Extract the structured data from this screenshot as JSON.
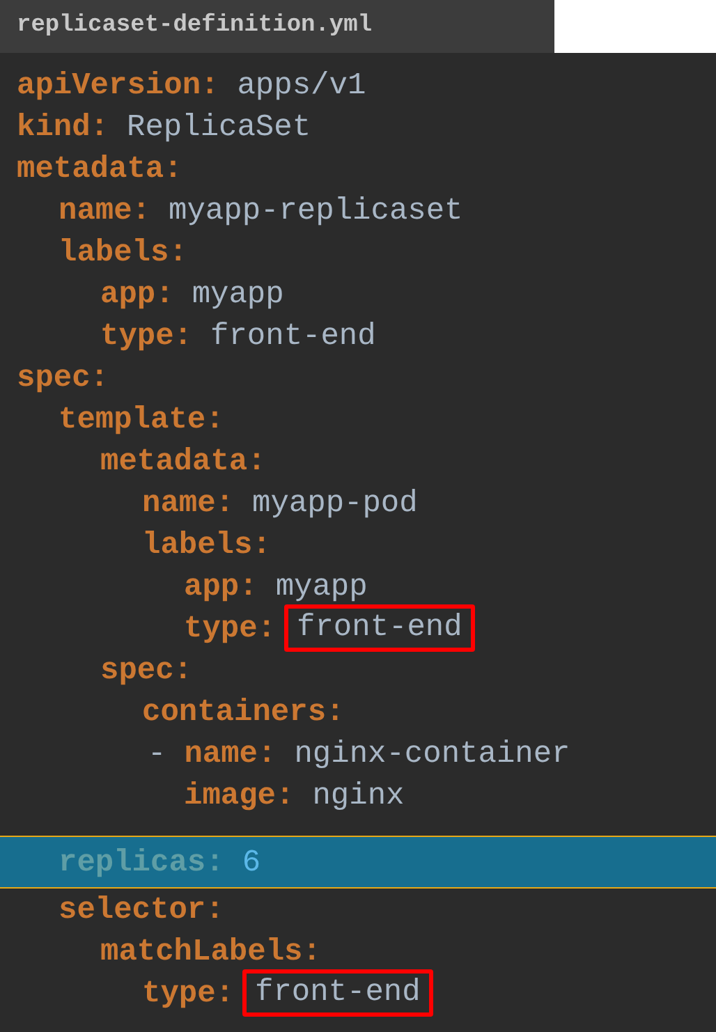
{
  "tab": {
    "title": "replicaset-definition.yml"
  },
  "lines": [
    {
      "key": "apiVersion:",
      "value": "apps/v1"
    },
    {
      "key": "kind:",
      "value": "ReplicaSet"
    },
    {
      "key": "metadata:",
      "children": [
        {
          "key": "name:",
          "value": "myapp-replicaset"
        },
        {
          "key": "labels:",
          "children": [
            {
              "key": "app:",
              "value": "myapp"
            },
            {
              "key": "type:",
              "value": "front-end"
            }
          ]
        }
      ]
    },
    {
      "key": "spec:",
      "children": [
        {
          "key": "template:",
          "children": [
            {
              "key": "metadata:",
              "children": [
                {
                  "key": "name:",
                  "value": "myapp-pod"
                },
                {
                  "key": "labels:",
                  "children": [
                    {
                      "key": "app:",
                      "value": "myapp"
                    },
                    {
                      "key": "type:",
                      "value": "front-end",
                      "boxed": true
                    }
                  ]
                }
              ]
            },
            {
              "key": "spec:",
              "children": [
                {
                  "key": "containers:",
                  "children": [
                    {
                      "prefix": "-",
                      "key": "name:",
                      "value": "nginx-container"
                    },
                    {
                      "key": "image:",
                      "value": "nginx"
                    }
                  ]
                }
              ]
            }
          ]
        },
        {
          "key": "replicas:",
          "value": "6",
          "highlighted": true
        },
        {
          "key": "selector:",
          "children": [
            {
              "key": "matchLabels:",
              "children": [
                {
                  "key": "type:",
                  "value": "front-end",
                  "boxed": true
                }
              ]
            }
          ]
        }
      ]
    }
  ]
}
